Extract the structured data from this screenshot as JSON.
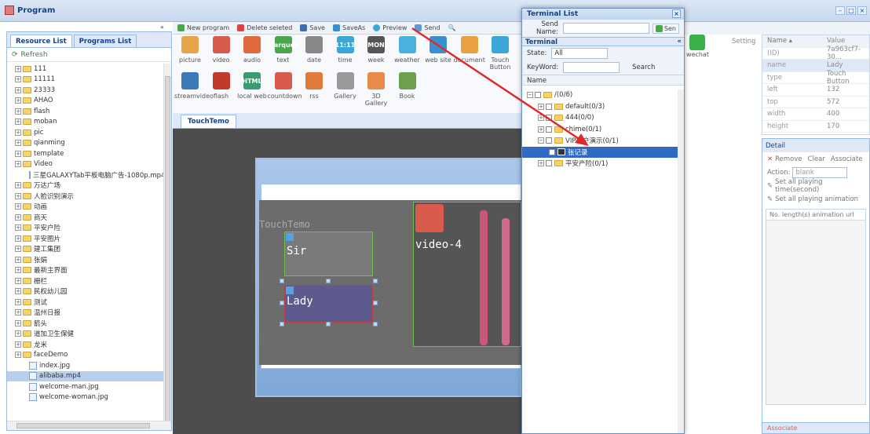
{
  "window": {
    "title": "Program"
  },
  "left_panel": {
    "tabs": [
      "Resource List",
      "Programs List"
    ],
    "refresh": "Refresh",
    "tree": [
      {
        "label": "111",
        "type": "folder",
        "level": 0
      },
      {
        "label": "11111",
        "type": "folder",
        "level": 0
      },
      {
        "label": "23333",
        "type": "folder",
        "level": 0
      },
      {
        "label": "AHAO",
        "type": "folder",
        "level": 0
      },
      {
        "label": "flash",
        "type": "folder",
        "level": 0
      },
      {
        "label": "moban",
        "type": "folder",
        "level": 0
      },
      {
        "label": "pic",
        "type": "folder",
        "level": 0
      },
      {
        "label": "qianming",
        "type": "folder",
        "level": 0
      },
      {
        "label": "template",
        "type": "folder",
        "level": 0
      },
      {
        "label": "Video",
        "type": "folder",
        "level": 0
      },
      {
        "label": "三星GALAXYTab平板电脑广告-1080p.mp4",
        "type": "file",
        "level": 1
      },
      {
        "label": "万达广场",
        "type": "folder",
        "level": 0
      },
      {
        "label": "人脸识别演示",
        "type": "folder",
        "level": 0
      },
      {
        "label": "动画",
        "type": "folder",
        "level": 0
      },
      {
        "label": "商天",
        "type": "folder",
        "level": 0
      },
      {
        "label": "平安户险",
        "type": "folder",
        "level": 0
      },
      {
        "label": "平安图片",
        "type": "folder",
        "level": 0
      },
      {
        "label": "建工集团",
        "type": "folder",
        "level": 0
      },
      {
        "label": "张娟",
        "type": "folder",
        "level": 0
      },
      {
        "label": "最新主界面",
        "type": "folder",
        "level": 0
      },
      {
        "label": "栅栏",
        "type": "folder",
        "level": 0
      },
      {
        "label": "民权幼儿园",
        "type": "folder",
        "level": 0
      },
      {
        "label": "测试",
        "type": "folder",
        "level": 0
      },
      {
        "label": "温州日报",
        "type": "folder",
        "level": 0
      },
      {
        "label": "箭头",
        "type": "folder",
        "level": 0
      },
      {
        "label": "道加卫生保健",
        "type": "folder",
        "level": 0
      },
      {
        "label": "龙米",
        "type": "folder",
        "level": 0
      },
      {
        "label": "faceDemo",
        "type": "folder",
        "level": 0
      },
      {
        "label": "index.jpg",
        "type": "file",
        "level": 1
      },
      {
        "label": "alibaba.mp4",
        "type": "file",
        "level": 1,
        "selected": true
      },
      {
        "label": "welcome-man.jpg",
        "type": "file",
        "level": 1
      },
      {
        "label": "welcome-woman.jpg",
        "type": "file",
        "level": 1
      }
    ]
  },
  "toolbar": {
    "new_program": "New program",
    "delete_selected": "Delete seleted",
    "save": "Save",
    "saveas": "SaveAs",
    "preview": "Preview",
    "send": "Send"
  },
  "palette": [
    {
      "label": "picture",
      "color": "#e8a44a"
    },
    {
      "label": "video",
      "color": "#d95b4e"
    },
    {
      "label": "audio",
      "color": "#e06a3b"
    },
    {
      "label": "text",
      "color": "#4aa64a",
      "glyph": "marquee"
    },
    {
      "label": "date",
      "color": "#888888"
    },
    {
      "label": "time",
      "color": "#3aa7d8",
      "glyph": "11:11"
    },
    {
      "label": "week",
      "color": "#555555",
      "glyph": "MON"
    },
    {
      "label": "weather",
      "color": "#4ab0e0"
    },
    {
      "label": "web site",
      "color": "#3a8fd0"
    },
    {
      "label": "document",
      "color": "#e8a040"
    },
    {
      "label": "Touch Button",
      "color": "#3aa7d8"
    },
    {
      "label": "streamvideo",
      "color": "#3a7ab8"
    },
    {
      "label": "flash",
      "color": "#c03a2e"
    },
    {
      "label": "local web",
      "color": "#3a9a70",
      "glyph": "HTML"
    },
    {
      "label": "countdown",
      "color": "#d95b4e"
    },
    {
      "label": "rss",
      "color": "#e07a3a"
    },
    {
      "label": "Gallery",
      "color": "#999999"
    },
    {
      "label": "3D Gallery",
      "color": "#e88a4a"
    },
    {
      "label": "Book",
      "color": "#6aa050"
    }
  ],
  "extra_palette": {
    "label": "wechat",
    "color": "#3ab04a"
  },
  "editor": {
    "tab": "TouchTemo",
    "stage_label": "TouchTemo",
    "elements": {
      "sir": "Sir",
      "lady": "Lady",
      "video": "video-4"
    }
  },
  "terminal_dialog": {
    "title": "Terminal List",
    "send_name_label": "Send Name:",
    "send_name_value": "",
    "send_button": "Sen",
    "section": "Terminal",
    "state_label": "State:",
    "state_value": "All",
    "keyword_label": "KeyWord:",
    "search_button": "Search",
    "name_header": "Name",
    "tree": [
      {
        "label": "/(0/6)",
        "level": 0,
        "open": true
      },
      {
        "label": "default(0/3)",
        "level": 1
      },
      {
        "label": "444(0/0)",
        "level": 1
      },
      {
        "label": "chime(0/1)",
        "level": 1
      },
      {
        "label": "VIP客户演示(0/1)",
        "level": 1,
        "open": true
      },
      {
        "label": "张记录",
        "level": 2,
        "selected": true,
        "checked": true
      },
      {
        "label": "平安产险(0/1)",
        "level": 1
      }
    ]
  },
  "properties": {
    "setting": "Setting",
    "headers": [
      "Name",
      "Value"
    ],
    "rows": [
      {
        "name": "(ID)",
        "value": "7a963cf7-30..."
      },
      {
        "name": "name",
        "value": "Lady"
      },
      {
        "name": "type",
        "value": "Touch Button"
      },
      {
        "name": "left",
        "value": "132"
      },
      {
        "name": "top",
        "value": "572"
      },
      {
        "name": "width",
        "value": "400"
      },
      {
        "name": "height",
        "value": "170"
      }
    ]
  },
  "detail": {
    "title": "Detail",
    "remove": "Remove",
    "clear": "Clear",
    "associate": "Associate",
    "action_label": "Action:",
    "action_value": "blank",
    "set_time": "Set all playing time(second)",
    "set_anim": "Set all playing animation",
    "columns": [
      "No.",
      "length(s)",
      "animation",
      "url"
    ],
    "footer": "Associate"
  }
}
